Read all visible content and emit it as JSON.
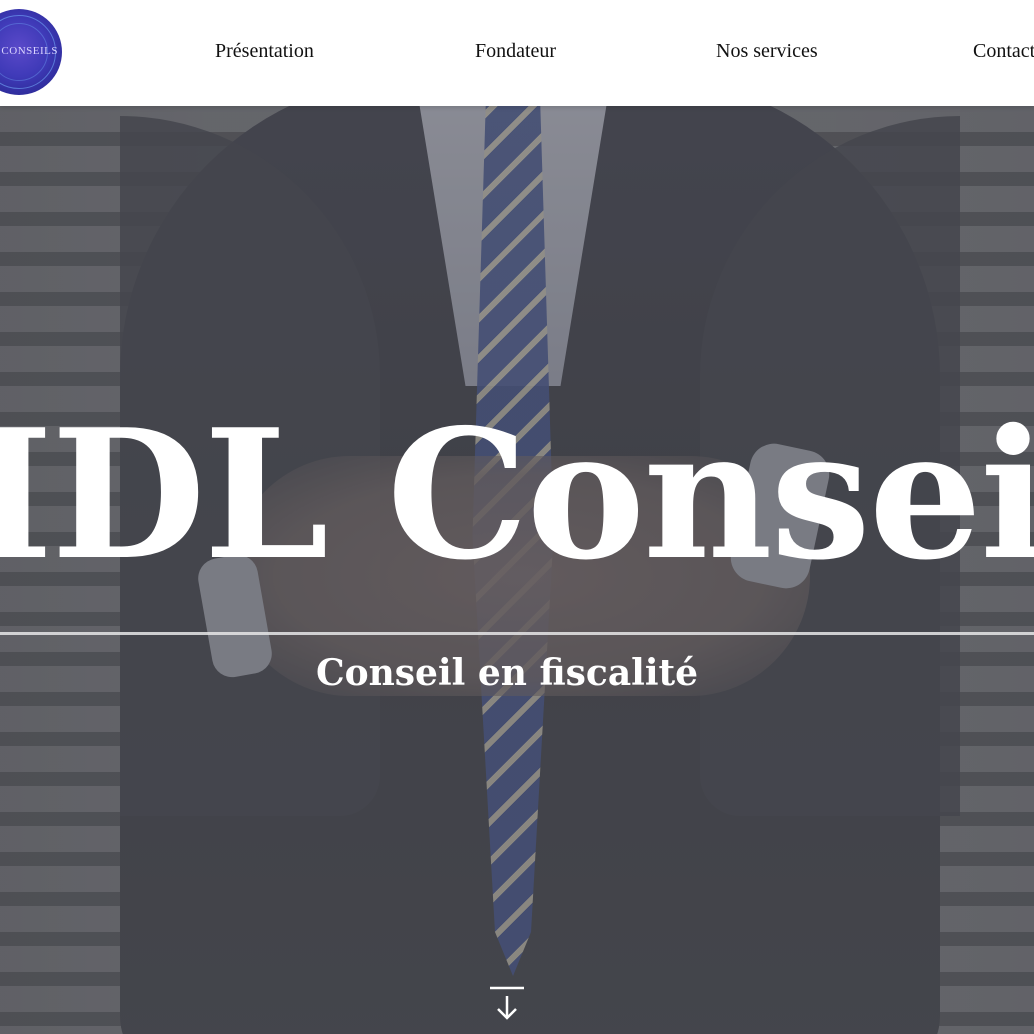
{
  "header": {
    "logo_text": "L CONSEILS",
    "nav": [
      {
        "label": "Présentation"
      },
      {
        "label": "Fondateur"
      },
      {
        "label": "Nos services"
      },
      {
        "label": "Contact"
      }
    ]
  },
  "hero": {
    "title": "IDL Conseil",
    "subtitle": "Conseil en fiscalité",
    "scroll_icon": "arrow-down-to-line-icon"
  },
  "colors": {
    "header_bg": "#ffffff",
    "logo_blue": "#3f3ab8",
    "hero_text": "#ffffff",
    "tie_blue": "#3b4e8e"
  }
}
